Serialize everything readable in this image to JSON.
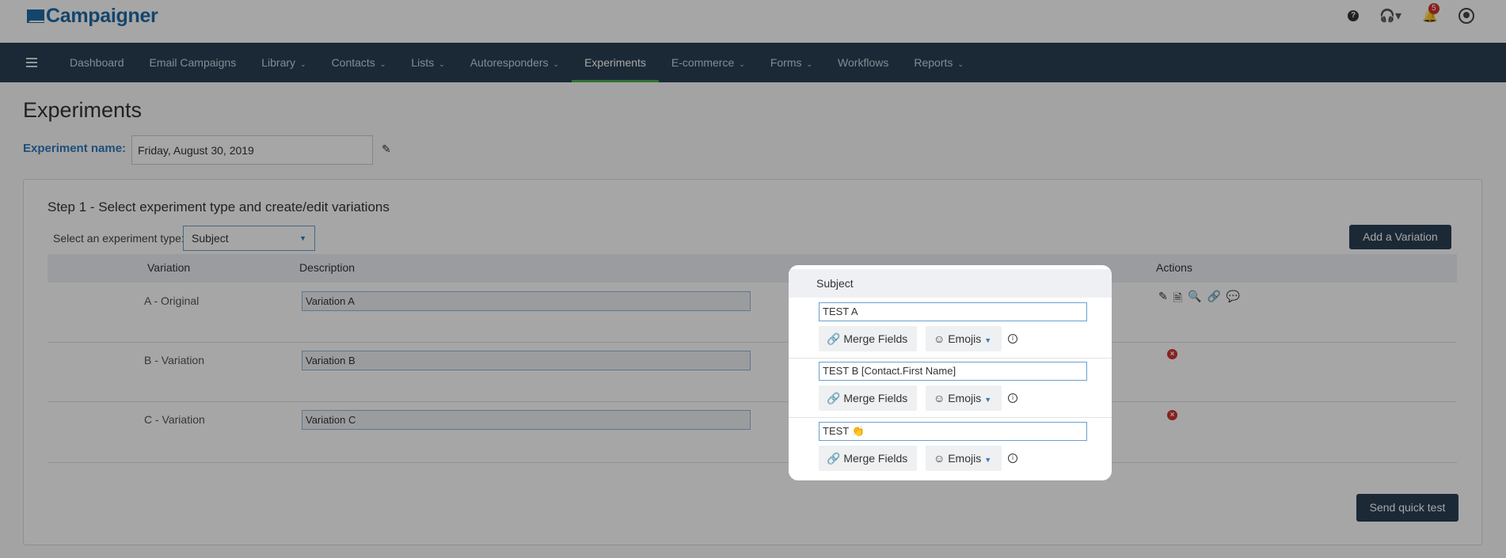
{
  "app": {
    "logo_text": "Campaigner",
    "notification_count": "5"
  },
  "nav": {
    "items": [
      {
        "label": "Dashboard",
        "dropdown": false
      },
      {
        "label": "Email Campaigns",
        "dropdown": false
      },
      {
        "label": "Library",
        "dropdown": true
      },
      {
        "label": "Contacts",
        "dropdown": true
      },
      {
        "label": "Lists",
        "dropdown": true
      },
      {
        "label": "Autoresponders",
        "dropdown": true
      },
      {
        "label": "Experiments",
        "dropdown": false,
        "active": true
      },
      {
        "label": "E-commerce",
        "dropdown": true
      },
      {
        "label": "Forms",
        "dropdown": true
      },
      {
        "label": "Workflows",
        "dropdown": false
      },
      {
        "label": "Reports",
        "dropdown": true
      }
    ]
  },
  "page": {
    "title": "Experiments",
    "experiment_name_label": "Experiment name:",
    "experiment_name_value": "Friday, August 30, 2019"
  },
  "step1": {
    "title": "Step 1 - Select experiment type and create/edit variations",
    "type_label": "Select an experiment type:",
    "type_value": "Subject",
    "add_variation": "Add a Variation",
    "send_quick_test": "Send quick test",
    "columns": {
      "variation": "Variation",
      "description": "Description",
      "subject": "Subject",
      "actions": "Actions"
    },
    "rows": [
      {
        "variation": "A - Original",
        "description": "Variation A",
        "subject": "TEST A"
      },
      {
        "variation": "B - Variation",
        "description": "Variation B",
        "subject": "TEST B [Contact.First Name]"
      },
      {
        "variation": "C - Variation",
        "description": "Variation C",
        "subject": "TEST 👏"
      }
    ],
    "merge_fields_label": "Merge Fields",
    "emojis_label": "Emojis"
  }
}
